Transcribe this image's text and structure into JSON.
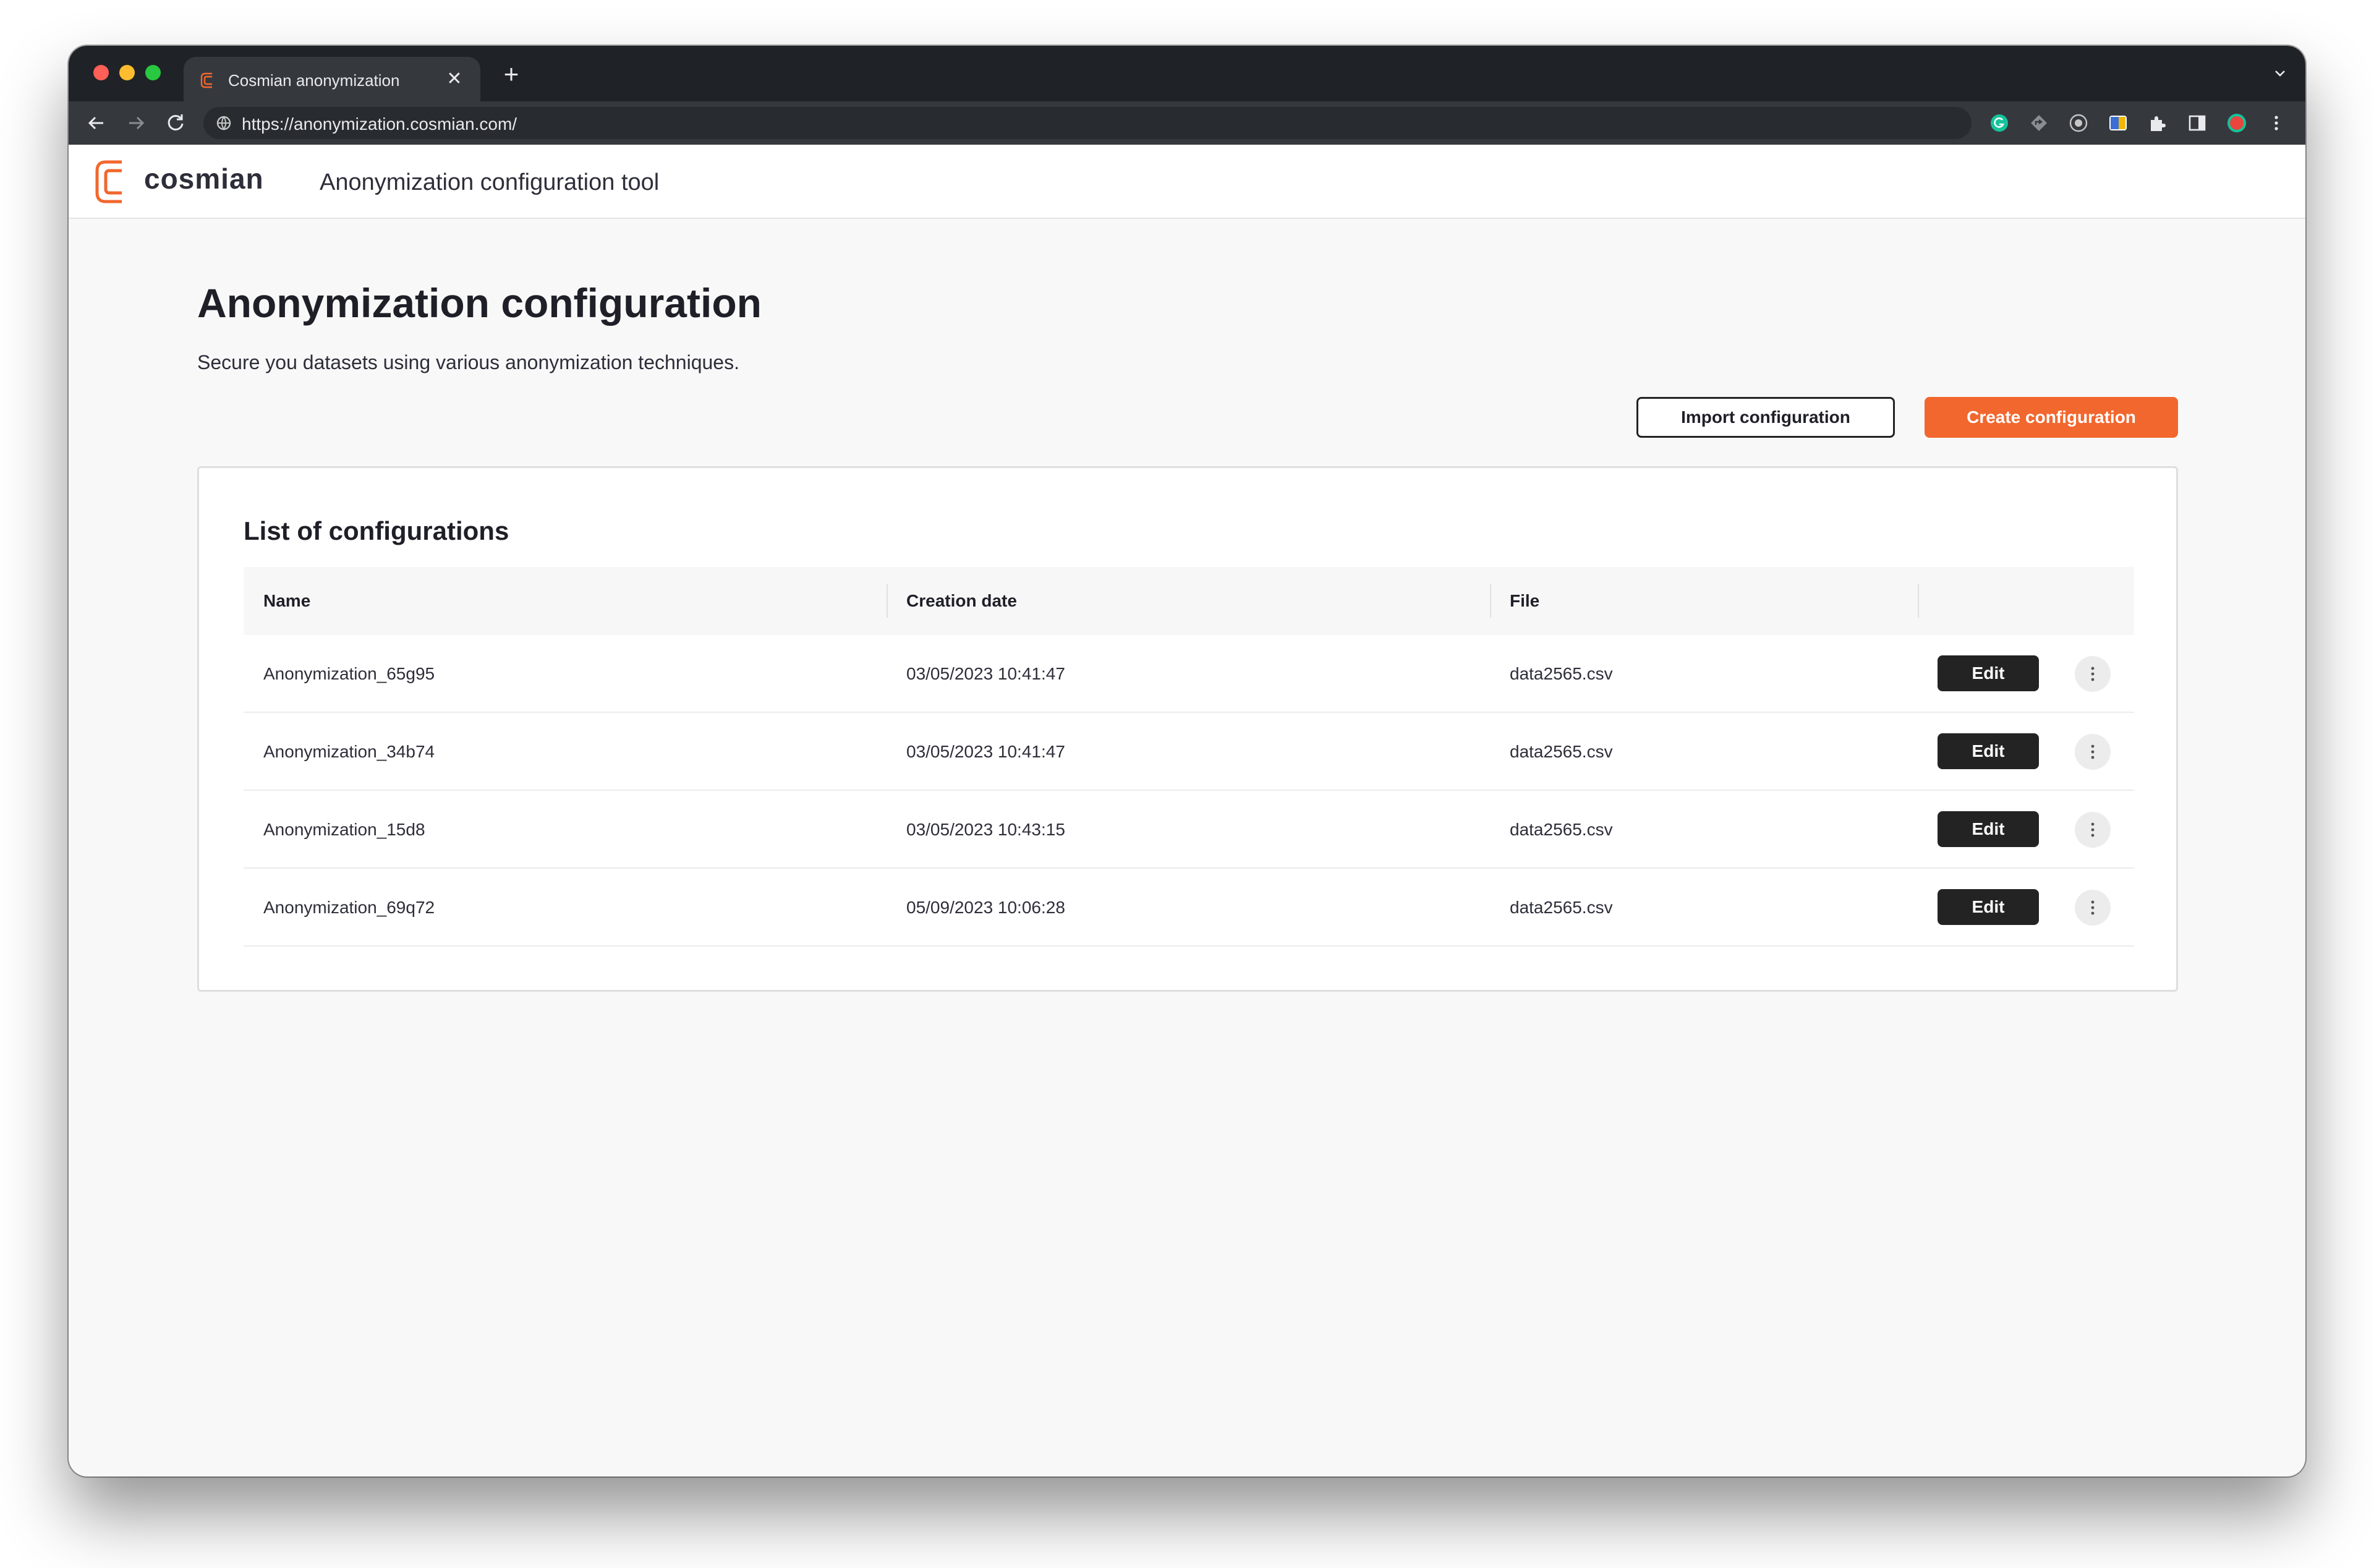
{
  "browser": {
    "tab_title": "Cosmian anonymization",
    "url": "https://anonymization.cosmian.com/",
    "tab_close": "✕",
    "new_tab": "+"
  },
  "header": {
    "brand": "cosmian",
    "tool_name": "Anonymization configuration tool",
    "accent_color": "#f2672e"
  },
  "page": {
    "title": "Anonymization configuration",
    "subtitle": "Secure you datasets using various anonymization techniques.",
    "import_label": "Import configuration",
    "create_label": "Create configuration"
  },
  "card": {
    "title": "List of configurations",
    "columns": [
      "Name",
      "Creation date",
      "File"
    ],
    "rows": [
      {
        "name": "Anonymization_65g95",
        "date": "03/05/2023 10:41:47",
        "file": "data2565.csv",
        "edit": "Edit"
      },
      {
        "name": "Anonymization_34b74",
        "date": "03/05/2023 10:41:47",
        "file": "data2565.csv",
        "edit": "Edit"
      },
      {
        "name": "Anonymization_15d8",
        "date": "03/05/2023 10:43:15",
        "file": "data2565.csv",
        "edit": "Edit"
      },
      {
        "name": "Anonymization_69q72",
        "date": "05/09/2023 10:06:28",
        "file": "data2565.csv",
        "edit": "Edit"
      }
    ]
  }
}
